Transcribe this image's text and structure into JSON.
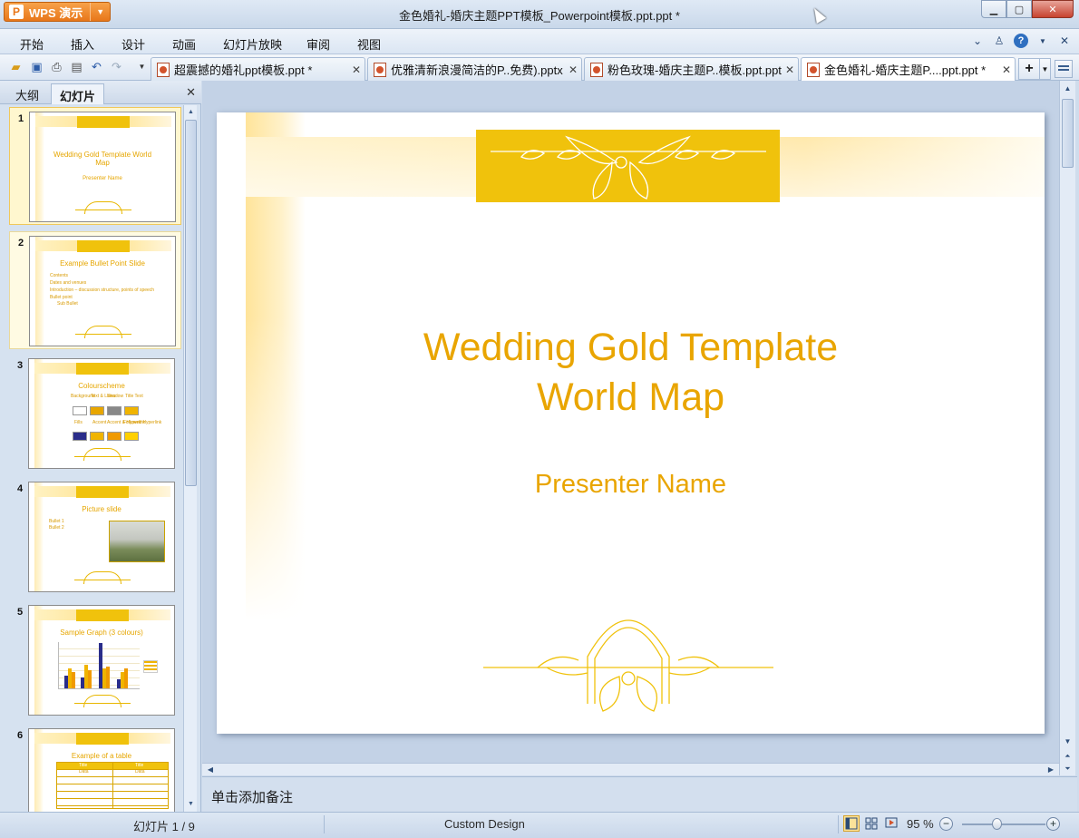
{
  "app": {
    "name": "WPS 演示",
    "window_title": "金色婚礼-婚庆主题PPT模板_Powerpoint模板.ppt.ppt *"
  },
  "menu": {
    "items": [
      "开始",
      "插入",
      "设计",
      "动画",
      "幻灯片放映",
      "审阅",
      "视图"
    ]
  },
  "doc_tabs": [
    {
      "label": "超震撼的婚礼ppt模板.ppt *",
      "active": false
    },
    {
      "label": "优雅清新浪漫简洁的P..免费).pptx *",
      "active": false
    },
    {
      "label": "粉色玫瑰-婚庆主题P..模板.ppt.ppt",
      "active": false
    },
    {
      "label": "金色婚礼-婚庆主题P....ppt.ppt *",
      "active": true
    }
  ],
  "left_pane": {
    "tabs": [
      "大纲",
      "幻灯片"
    ],
    "active_tab": "幻灯片",
    "slides": [
      {
        "num": "1",
        "title": "Wedding Gold Template World Map",
        "subtitle": "Presenter Name"
      },
      {
        "num": "2",
        "title": "Example Bullet Point Slide",
        "bullets": [
          "Contents",
          "Dates and venues",
          "Introduction – discussion structure, points of speech",
          "Bullet point",
          "Sub Bullet"
        ]
      },
      {
        "num": "3",
        "title": "Colourscheme",
        "labels": [
          "Background",
          "Text & Lines",
          "Shadow",
          "Title Text",
          "Fills",
          "Accent",
          "Accent & Hyperlink",
          "Followed Hyperlink"
        ]
      },
      {
        "num": "4",
        "title": "Picture slide",
        "bullets": [
          "Bullet 1",
          "Bullet 2"
        ]
      },
      {
        "num": "5",
        "title": "Sample Graph (3 colours)"
      },
      {
        "num": "6",
        "title": "Example of a table",
        "headers": [
          "Title",
          "Title"
        ],
        "row1": [
          "Data",
          "Data"
        ]
      }
    ]
  },
  "slide": {
    "title_line1": "Wedding Gold Template",
    "title_line2": "World Map",
    "subtitle": "Presenter Name"
  },
  "notes": {
    "placeholder": "单击添加备注"
  },
  "status": {
    "slide_counter": "幻灯片 1 / 9",
    "design": "Custom Design",
    "zoom": "95 %",
    "zoom_fraction": 0.5
  },
  "colors": {
    "gold": "#f0c20c",
    "gold_text": "#e9a500",
    "accent_orange": "#e8771a"
  }
}
